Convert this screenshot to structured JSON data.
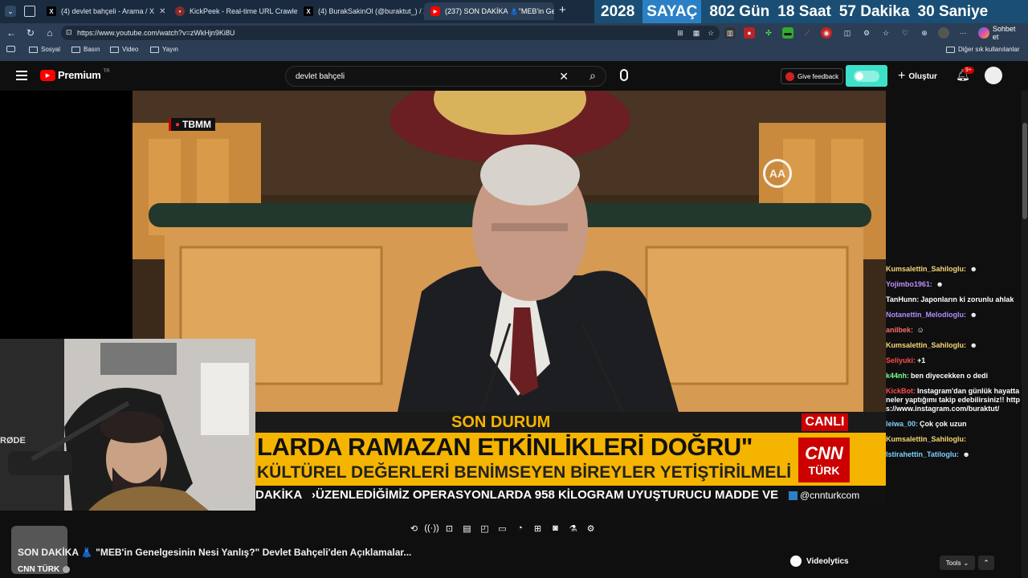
{
  "browser": {
    "tabs": [
      {
        "label": "(4) devlet bahçeli - Arama / X",
        "icon": "x-icon"
      },
      {
        "label": "KickPeek - Real-time URL Crawler",
        "icon": "kickpeek-icon"
      },
      {
        "label": "(4) BurakSakinOl (@buraktut_) / X",
        "icon": "x-icon"
      },
      {
        "label": "(237) SON DAKİKA 👗\"MEB'in Gen",
        "icon": "youtube-icon"
      }
    ],
    "new_tab": "+",
    "counter": {
      "label1": "2028",
      "label2": "SAYAÇ",
      "days": "802 Gün",
      "hours": "18 Saat",
      "minutes": "57 Dakika",
      "seconds": "30 Saniye"
    },
    "url": "https://www.youtube.com/watch?v=zWkHjn9Ki8U",
    "chat_button": "Sohbet et",
    "bookmarks": [
      "Sosyal",
      "Basın",
      "Video",
      "Yayın"
    ],
    "other_bookmarks": "Diğer sık kullanılanlar"
  },
  "youtube": {
    "logo_text": "Premium",
    "logo_sup": "TR",
    "search_value": "devlet bahçeli",
    "feedback": "Give feedback",
    "create": "Oluştur",
    "notif_count": "9+"
  },
  "video": {
    "badge": "TBMM",
    "ticker_label": "SON DURUM",
    "live": "CANLI",
    "headline1": "LARDA RAMAZAN ETKİNLİKLERİ DOĞRU\"",
    "headline2": "KÜLTÜREL DEĞERLERİ BENİMSEYEN BİREYLER YETİŞTİRİLMELİ",
    "crawl_label": "DAKİKA",
    "crawl_text": "›ÜZENLEDİĞİMİZ OPERASYONLARDA 958 KİLOGRAM UYUŞTURUCU MADDE VE 1 M",
    "cnn1": "CNN",
    "cnn2": "TÜRK",
    "handle": "@cnnturkcom",
    "mic_brand": "RØDE"
  },
  "chat": [
    {
      "user": "Kumsalettin_Sahiloglu:",
      "text": "",
      "color": "#f7d774"
    },
    {
      "user": "Yojimbo1961:",
      "text": "",
      "color": "#c48cff"
    },
    {
      "user": "TanHunn:",
      "text": "Japonların ki zorunlu ahlak",
      "color": "#ffffff"
    },
    {
      "user": "Notanettin_Melodioglu:",
      "text": "",
      "color": "#b38cff"
    },
    {
      "user": "anilbek:",
      "text": "",
      "color": "#ff6a6a"
    },
    {
      "user": "Kumsalettin_Sahiloglu:",
      "text": "",
      "color": "#f7d774"
    },
    {
      "user": "Seliyuki:",
      "text": "+1",
      "color": "#ff4a4a"
    },
    {
      "user": "k44nh:",
      "text": "ben diyecekken o dedi",
      "color": "#7dff8a"
    },
    {
      "user": "KickBot:",
      "text": "Instagram'dan günlük hayatta neler yaptığımı takip edebilirsiniz!! https://www.instagram.com/buraktut/",
      "color": "#ff4a4a"
    },
    {
      "user": "leiwa_00:",
      "text": "Çok çok uzun",
      "color": "#7fd0ff"
    },
    {
      "user": "Kumsalettin_Sahiloglu:",
      "text": "",
      "color": "#f7d774"
    },
    {
      "user": "Istirahettin_Tatiloglu:",
      "text": "",
      "color": "#7fd0ff"
    }
  ],
  "below": {
    "title": "SON DAKİKA 👗 \"MEB'in Genelgesinin Nesi Yanlış?\" Devlet Bahçeli'den Açıklamalar...",
    "channel": "CNN TÜRK",
    "videolytics": "Videolytics",
    "tools": "Tools"
  },
  "colors": {
    "accent": "#2b80c5",
    "cnn_red": "#cc0000",
    "ticker_yellow": "#f5b400"
  }
}
